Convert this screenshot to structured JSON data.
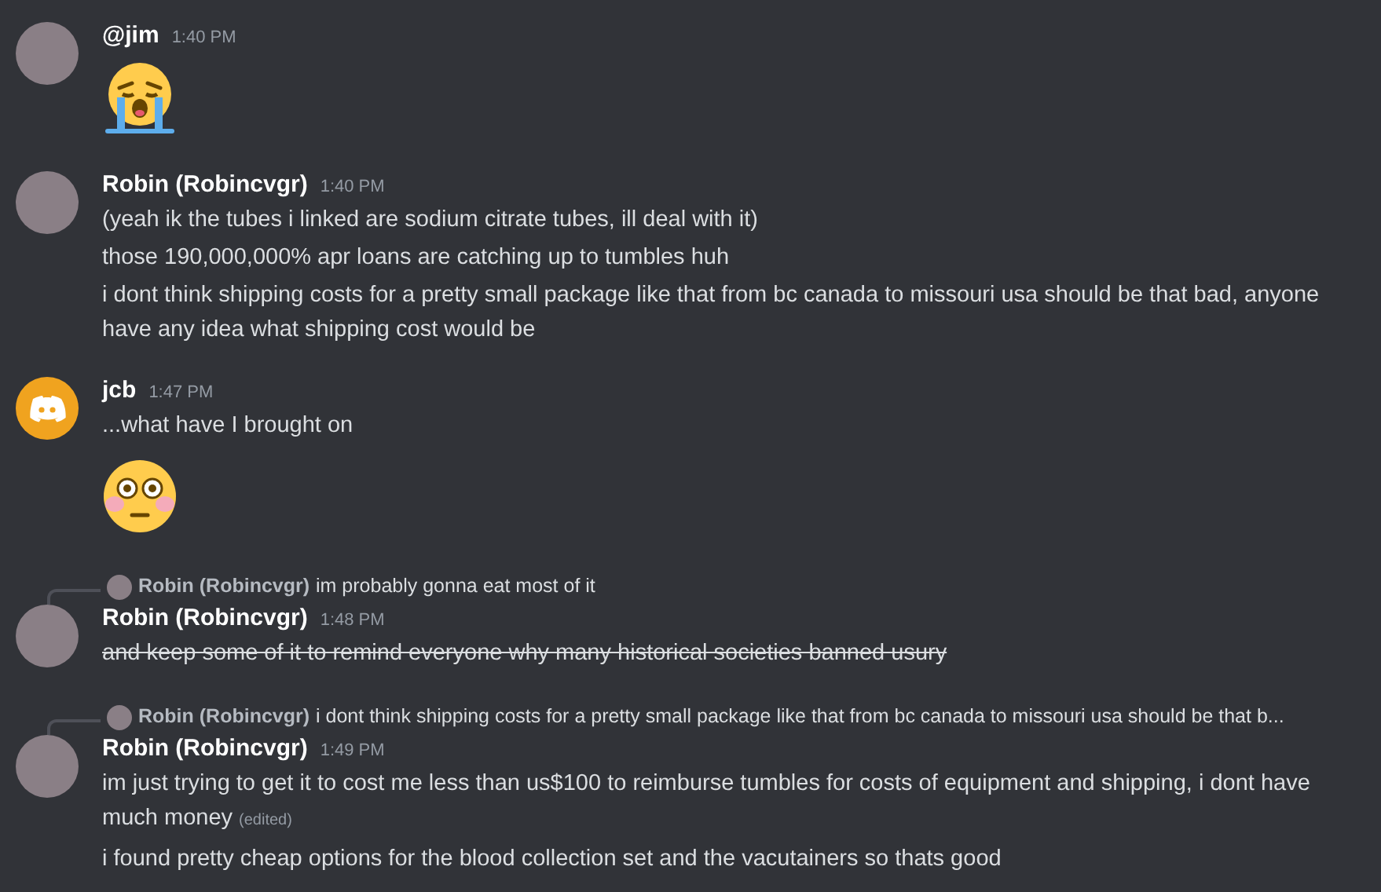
{
  "messages": [
    {
      "author": "@jim",
      "time": "1:40 PM",
      "avatar": {
        "kind": "photo"
      },
      "blocks": [
        {
          "kind": "crying-emoji"
        }
      ]
    },
    {
      "author": "Robin (Robincvgr)",
      "time": "1:40 PM",
      "avatar": {
        "kind": "photo"
      },
      "blocks": [
        {
          "kind": "text",
          "text": "(yeah ik the tubes i linked are sodium citrate tubes, ill deal with it)",
          "struck": false
        },
        {
          "kind": "text",
          "text": "those 190,000,000% apr loans are catching up to tumbles huh",
          "struck": false
        },
        {
          "kind": "text",
          "text": "i dont think shipping costs for a pretty small package like that from bc canada to missouri usa should be that bad, anyone have any idea what shipping cost would be",
          "struck": false
        }
      ]
    },
    {
      "author": "jcb",
      "time": "1:47 PM",
      "avatar": {
        "kind": "app-logo"
      },
      "blocks": [
        {
          "kind": "text",
          "text": "...what have I brought on",
          "struck": false
        },
        {
          "kind": "flushed-emoji"
        }
      ]
    },
    {
      "author": "Robin (Robincvgr)",
      "time": "1:48 PM",
      "avatar": {
        "kind": "photo"
      },
      "reply": {
        "author": "Robin (Robincvgr)",
        "text": "im probably gonna eat most of it"
      },
      "blocks": [
        {
          "kind": "text",
          "text": "and keep some of it to remind everyone why many historical societies banned usury",
          "struck": true
        }
      ]
    },
    {
      "author": "Robin (Robincvgr)",
      "time": "1:49 PM",
      "avatar": {
        "kind": "photo"
      },
      "reply": {
        "author": "Robin (Robincvgr)",
        "text": "i dont think shipping costs for a pretty small package like that from bc canada to missouri usa should be that b..."
      },
      "blocks": [
        {
          "kind": "text",
          "text": "im just trying to get it to cost me less than us$100 to reimburse tumbles for costs of equipment and shipping, i dont have much money",
          "struck": false,
          "edited_label": "(edited)"
        },
        {
          "kind": "text",
          "text": "i found pretty cheap options for the blood collection set and the vacutainers so thats good",
          "struck": false
        }
      ]
    }
  ]
}
